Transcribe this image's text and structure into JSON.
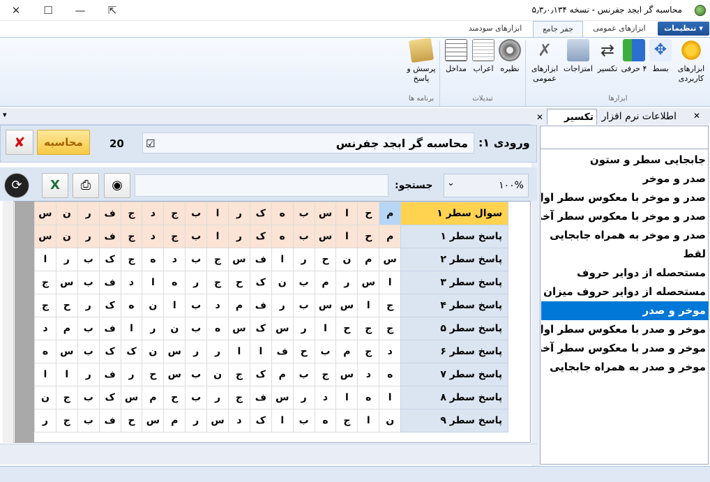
{
  "window": {
    "title": "محاسبه گر ابجد جفرنس - نسخه ۵٫۳٫۰٫۱۳۴",
    "min_icon": "—",
    "max_icon": "☐",
    "restore_icon": "⇱",
    "close_icon": "✕"
  },
  "ribbon_tabs": {
    "settings": "تنظیمات",
    "general_tools": "ابزارهای عمومی",
    "jafr_jame": "جفر جامع",
    "useful_tools": "ابزارهای سودمند"
  },
  "ribbon": {
    "applied_tools": "ابزارهای کاربردی",
    "bast": "بسط",
    "four_letter": "۴ حرفی",
    "takseer": "تکسیر",
    "emtezajat": "امتزاجات",
    "general_tools": "ابزارهای عمومی",
    "nazireh": "نظیره",
    "earab": "اعراب",
    "madakhel": "مداخل",
    "porsesh": "پرسش و پاسخ",
    "group_tools": "ابزارها",
    "group_tabdilat": "تبدیلات",
    "group_programs": "برنامه ها"
  },
  "left_header": {
    "dropdown": "▾"
  },
  "right_tabs": {
    "info": "اطلاعات نرم افزار",
    "takseer": "تکسیر",
    "close": "✕"
  },
  "input": {
    "label": "ورودی ۱:",
    "value": "محاسبه گر ابجد جفرنس",
    "checkbox": "☑",
    "count": "20",
    "calc": "محاسبه",
    "cancel": "✘"
  },
  "toolbar": {
    "search_label": "جستجو:",
    "search_value": "",
    "zoom": "۱۰۰%",
    "zoom_arrow": "⌄",
    "refresh_icon": "⟳",
    "excel_icon": "X",
    "print_icon": "⎙",
    "camera_icon": "◉"
  },
  "grid": {
    "rows": [
      {
        "label": "سوال سطر ۱",
        "cells": [
          "م",
          "ح",
          "ا",
          "س",
          "ب",
          "ه",
          "ک",
          "ر",
          "ا",
          "ب",
          "ج",
          "د",
          "ج",
          "ف",
          "ر",
          "ن",
          "س"
        ]
      },
      {
        "label": "پاسخ سطر ۱",
        "cells": [
          "م",
          "ح",
          "ا",
          "س",
          "ب",
          "ه",
          "ک",
          "ر",
          "ا",
          "ب",
          "ج",
          "د",
          "ج",
          "ف",
          "ر",
          "ن",
          "س"
        ]
      },
      {
        "label": "پاسخ سطر ۲",
        "cells": [
          "س",
          "م",
          "ن",
          "ح",
          "ر",
          "ا",
          "ف",
          "س",
          "ج",
          "ب",
          "د",
          "ه",
          "ج",
          "ک",
          "ب",
          "ر",
          "ا"
        ]
      },
      {
        "label": "پاسخ سطر ۳",
        "cells": [
          "ا",
          "س",
          "ر",
          "م",
          "ب",
          "ن",
          "ک",
          "ح",
          "ج",
          "ر",
          "ه",
          "ا",
          "د",
          "ف",
          "ب",
          "س",
          "ج"
        ]
      },
      {
        "label": "پاسخ سطر ۴",
        "cells": [
          "ج",
          "ا",
          "س",
          "س",
          "ب",
          "ر",
          "ف",
          "م",
          "د",
          "ب",
          "ا",
          "ن",
          "ه",
          "ک",
          "ر",
          "ح",
          "ج"
        ]
      },
      {
        "label": "پاسخ سطر ۵",
        "cells": [
          "ج",
          "ج",
          "ح",
          "ا",
          "ر",
          "س",
          "ک",
          "س",
          "ه",
          "ب",
          "ن",
          "ر",
          "ا",
          "ف",
          "ب",
          "م",
          "د"
        ]
      },
      {
        "label": "پاسخ سطر ۶",
        "cells": [
          "د",
          "ج",
          "م",
          "ب",
          "ح",
          "ف",
          "ا",
          "ا",
          "ر",
          "ر",
          "س",
          "ن",
          "ک",
          "ک",
          "ب",
          "س",
          "ه"
        ]
      },
      {
        "label": "پاسخ سطر ۷",
        "cells": [
          "ه",
          "د",
          "س",
          "ج",
          "ب",
          "م",
          "ک",
          "ج",
          "ن",
          "ب",
          "س",
          "ح",
          "ر",
          "ف",
          "ر",
          "ا",
          "ا"
        ]
      },
      {
        "label": "پاسخ سطر ۸",
        "cells": [
          "ا",
          "ه",
          "ا",
          "د",
          "ر",
          "س",
          "ف",
          "ج",
          "ر",
          "ب",
          "ح",
          "م",
          "س",
          "ک",
          "ب",
          "ج",
          "ن"
        ]
      },
      {
        "label": "پاسخ سطر ۹",
        "cells": [
          "ن",
          "ا",
          "ج",
          "ه",
          "ب",
          "ا",
          "ک",
          "د",
          "س",
          "ر",
          "م",
          "س",
          "ح",
          "ف",
          "ب",
          "ج",
          "ر"
        ]
      }
    ]
  },
  "list": {
    "items": [
      "جابجایی سطر و ستون",
      "صدر و موخر",
      "صدر و موخر با معکوس سطر اول",
      "صدر و موخر با معکوس سطر آخر",
      "صدر و موخر به همراه جابجایی",
      "لقط",
      "مستحصله از دوایر حروف",
      "مستحصله از دوایر حروف میزان نفس",
      "موخر و صدر",
      "موخر و صدر با معکوس سطر اول",
      "موخر و صدر با معکوس سطر آخر",
      "موخر و صدر به همراه جابجایی"
    ],
    "selected_index": 8
  }
}
